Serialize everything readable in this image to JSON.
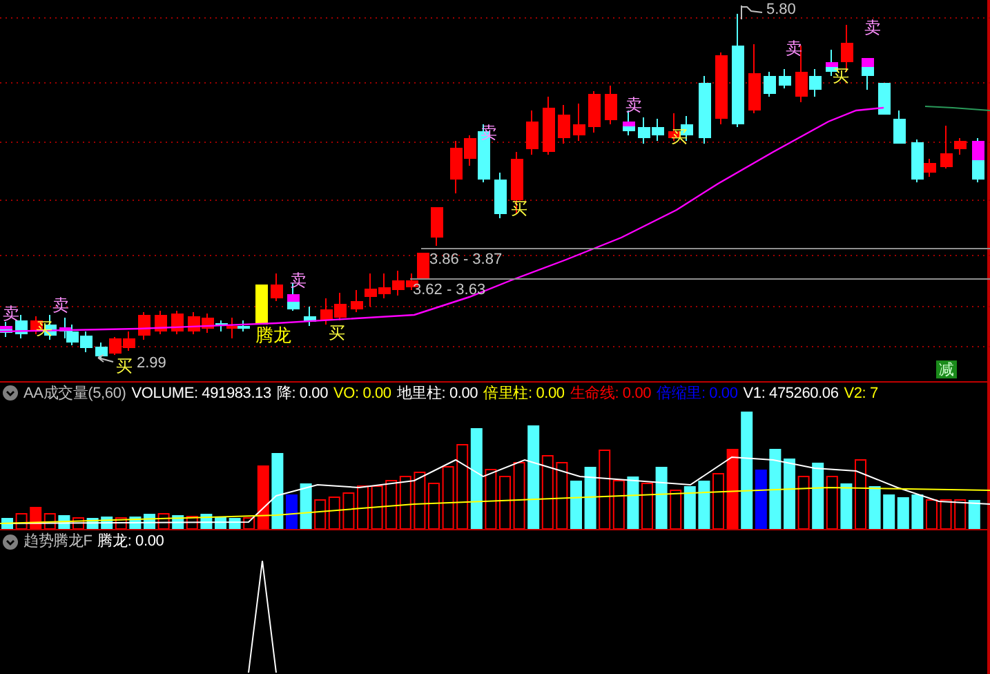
{
  "price_panel": {
    "high_label": "5.80",
    "low_label": "2.99",
    "ranges": [
      "3.86 - 3.87",
      "3.62 - 3.63"
    ],
    "signals": [
      {
        "kind": "sell",
        "text": "卖"
      },
      {
        "kind": "buy",
        "text": "买"
      },
      {
        "kind": "sell",
        "text": "卖"
      },
      {
        "kind": "buy",
        "text": "买"
      },
      {
        "kind": "dragon",
        "text": "腾龙"
      },
      {
        "kind": "sell",
        "text": "卖"
      },
      {
        "kind": "buy",
        "text": "买"
      },
      {
        "kind": "sell",
        "text": "卖"
      },
      {
        "kind": "buy",
        "text": "买"
      },
      {
        "kind": "sell",
        "text": "卖"
      },
      {
        "kind": "buy",
        "text": "买"
      },
      {
        "kind": "sell",
        "text": "卖"
      },
      {
        "kind": "buy",
        "text": "买"
      },
      {
        "kind": "sell",
        "text": "卖"
      }
    ],
    "badge": "减"
  },
  "volume_panel": {
    "legend": [
      {
        "text": "AA成交量(5,60)",
        "color": "#c0c0c0"
      },
      {
        "text": "VOLUME: 491983.13",
        "color": "#ffffff"
      },
      {
        "text": "降: 0.00",
        "color": "#ffffff"
      },
      {
        "text": "VO: 0.00",
        "color": "#ffff00"
      },
      {
        "text": "地里柱: 0.00",
        "color": "#ffffff"
      },
      {
        "text": "倍里柱: 0.00",
        "color": "#ffff00"
      },
      {
        "text": "生命线: 0.00",
        "color": "#ff0000"
      },
      {
        "text": "倍缩里: 0.00",
        "color": "#0000ff"
      },
      {
        "text": "V1: 475260.06",
        "color": "#ffffff"
      },
      {
        "text": "V2: 7",
        "color": "#ffff00"
      }
    ]
  },
  "indicator_panel": {
    "legend": [
      {
        "text": "趋势腾龙F",
        "color": "#c0c0c0"
      },
      {
        "text": "腾龙: 0.00",
        "color": "#ffffff"
      }
    ]
  }
}
